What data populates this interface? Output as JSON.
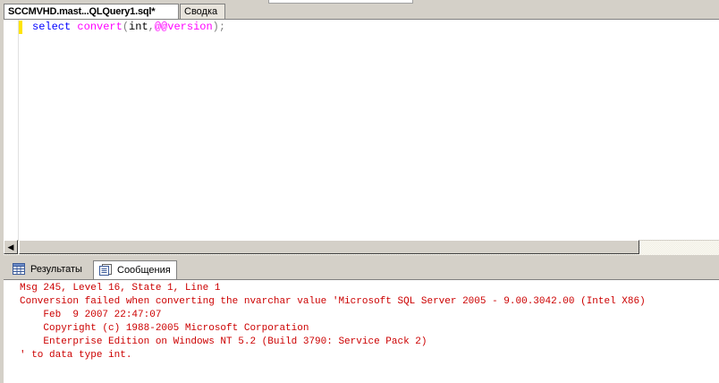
{
  "document_tabs": [
    {
      "label": "SCCMVHD.mast...QLQuery1.sql*",
      "active": true
    },
    {
      "label": "Сводка",
      "active": false
    }
  ],
  "editor": {
    "code": {
      "keyword_select": "select",
      "function_convert": "convert",
      "paren_open": "(",
      "arg_type": "int",
      "comma": ",",
      "global_var": "@@version",
      "paren_close": ")",
      "semicolon": ";"
    }
  },
  "result_tabs": [
    {
      "label": "Результаты",
      "icon": "grid-icon"
    },
    {
      "label": "Сообщения",
      "icon": "messages-icon",
      "active": true
    }
  ],
  "messages": [
    "Msg 245, Level 16, State 1, Line 1",
    "Conversion failed when converting the nvarchar value 'Microsoft SQL Server 2005 - 9.00.3042.00 (Intel X86)",
    "    Feb  9 2007 22:47:07",
    "    Copyright (c) 1988-2005 Microsoft Corporation",
    "    Enterprise Edition on Windows NT 5.2 (Build 3790: Service Pack 2)",
    "' to data type int."
  ],
  "colors": {
    "keyword": "#0000ff",
    "function": "#ff00ff",
    "operator": "#808080",
    "error_text": "#cc0000",
    "chrome": "#d4d0c8"
  }
}
